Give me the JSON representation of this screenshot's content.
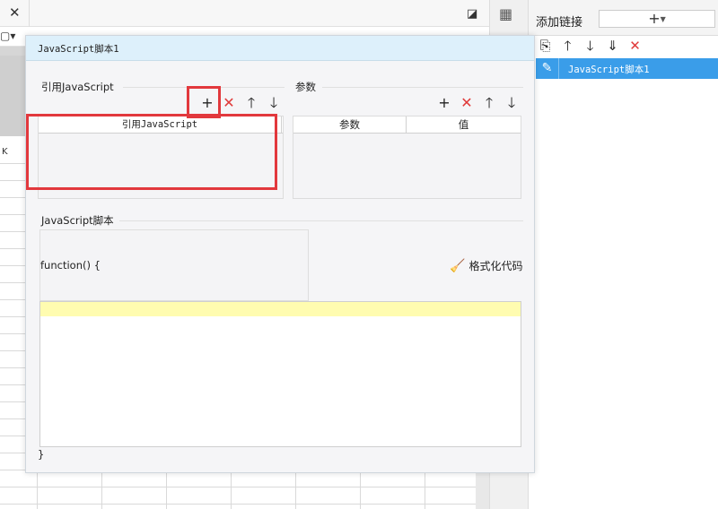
{
  "background": {
    "close_glyph": "✕",
    "column_label": "K"
  },
  "right_panel": {
    "title": "添加链接",
    "add_glyph": "+",
    "toolbar": [
      {
        "name": "copy-icon",
        "glyph": "⎘"
      },
      {
        "name": "arrow-up-icon",
        "glyph": "🡑"
      },
      {
        "name": "arrow-down-icon",
        "glyph": "🡓"
      },
      {
        "name": "sort-down-icon",
        "glyph": "⇓"
      },
      {
        "name": "delete-icon",
        "glyph": "✕"
      }
    ],
    "items": [
      {
        "label": "JavaScript脚本1",
        "icon": "pencil-icon",
        "selected": true
      }
    ]
  },
  "dialog": {
    "title": "JavaScript脚本1",
    "ref_section": {
      "label": "引用JavaScript",
      "column": "引用JavaScript"
    },
    "param_section": {
      "label": "参数",
      "columns": [
        "参数",
        "值"
      ]
    },
    "script_section": {
      "label": "JavaScript脚本",
      "function_open": "function() {",
      "function_close": "}",
      "format_button": "格式化代码"
    }
  },
  "colors": {
    "accent": "#3a9de9",
    "danger": "#e03a3a",
    "highlight_box": "#e2383d",
    "editor_line": "#fffcb0",
    "title_bar": "#ddf0fb"
  }
}
